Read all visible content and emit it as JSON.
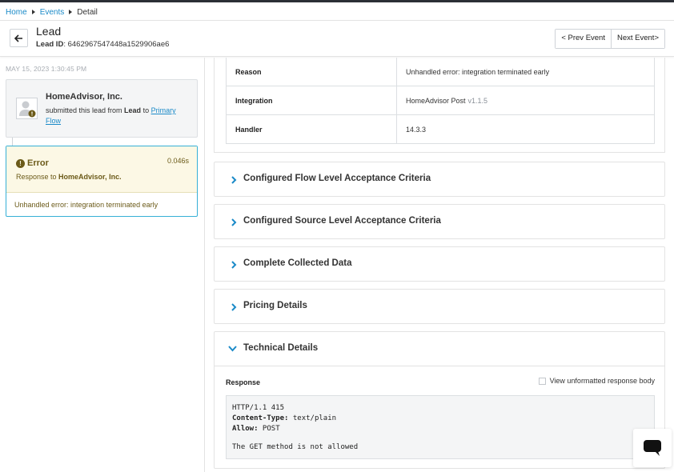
{
  "breadcrumb": {
    "home": "Home",
    "events": "Events",
    "current": "Detail"
  },
  "header": {
    "title": "Lead",
    "lead_id_label": "Lead ID",
    "lead_id_value": ": 6462967547448a1529906ae6",
    "prev_label": "< Prev Event",
    "next_label": "Next Event>"
  },
  "timeline": {
    "date": "MAY 15, 2023 1:30:45 PM",
    "source_name": "HomeAdvisor, Inc.",
    "source_text_1": "submitted this lead from ",
    "source_flow_word": "Lead",
    "source_text_2": " to ",
    "source_link": "Primary Flow",
    "error_title": "Error",
    "error_time": "0.046s",
    "error_resp_prefix": "Response to ",
    "error_resp_target": "HomeAdvisor, Inc.",
    "error_message": "Unhandled error: integration terminated early"
  },
  "details": {
    "rows": [
      {
        "key": "Reason",
        "value": "Unhandled error: integration terminated early",
        "extra": ""
      },
      {
        "key": "Integration",
        "value": "HomeAdvisor Post",
        "extra": "v1.1.5"
      },
      {
        "key": "Handler",
        "value": "14.3.3",
        "extra": ""
      }
    ]
  },
  "sections": [
    "Configured Flow Level Acceptance Criteria",
    "Configured Source Level Acceptance Criteria",
    "Complete Collected Data",
    "Pricing Details"
  ],
  "technical": {
    "title": "Technical Details",
    "response_label": "Response",
    "checkbox_label": "View unformatted response body",
    "line1": "HTTP/1.1 415",
    "ct_key": "Content-Type:",
    "ct_val": " text/plain",
    "allow_key": "Allow:",
    "allow_val": " POST",
    "body": "The GET method is not allowed"
  },
  "icons": {
    "back": "arrow-left-icon",
    "avatar": "user-avatar-icon",
    "error": "exclamation-circle-icon",
    "collapsed": "chevron-right-icon",
    "expanded": "chevron-down-icon",
    "chat": "chat-bubble-icon"
  },
  "colors": {
    "accent": "#1a8ac8",
    "error_bg": "#fcf8e5",
    "error_text": "#6b5a18",
    "selected_border": "#36b0d6"
  }
}
